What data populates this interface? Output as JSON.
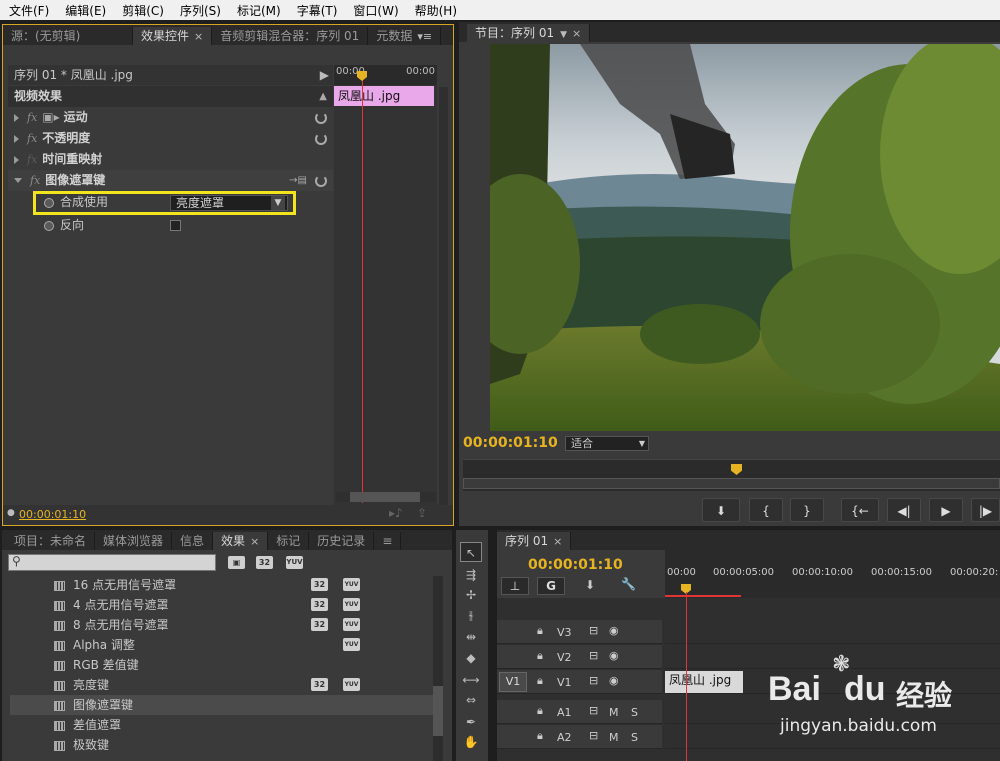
{
  "menu": [
    "文件(F)",
    "编辑(E)",
    "剪辑(C)",
    "序列(S)",
    "标记(M)",
    "字幕(T)",
    "窗口(W)",
    "帮助(H)"
  ],
  "source_tabs": {
    "source": "源：(无剪辑)",
    "effect_controls": "效果控件",
    "audio_mixer": "音频剪辑混合器：序列 01",
    "metadata": "元数据"
  },
  "ec": {
    "sequence": "序列 01 * 凤凰山 .jpg",
    "tc_start": "00:00",
    "tc_end": "00:00",
    "clip": "凤凰山 .jpg",
    "video_effects": "视频效果",
    "effects": [
      "运动",
      "不透明度",
      "时间重映射",
      "图像遮罩键"
    ],
    "composite_label": "合成使用",
    "composite_value": "亮度遮罩",
    "reverse_label": "反向",
    "timecode": "00:00:01:10"
  },
  "program": {
    "tab": "节目：序列 01",
    "timecode": "00:00:01:10",
    "fit": "适合"
  },
  "project_tabs": {
    "project": "项目：未命名",
    "media": "媒体浏览器",
    "info": "信息",
    "effects": "效果",
    "markers": "标记",
    "history": "历史记录"
  },
  "effects_list": [
    {
      "name": "16 点无用信号遮罩",
      "b32": true,
      "yuv": true
    },
    {
      "name": "4 点无用信号遮罩",
      "b32": true,
      "yuv": true
    },
    {
      "name": "8 点无用信号遮罩",
      "b32": true,
      "yuv": true
    },
    {
      "name": "Alpha 调整",
      "b32": false,
      "yuv": true
    },
    {
      "name": "RGB 差值键",
      "b32": false,
      "yuv": false
    },
    {
      "name": "亮度键",
      "b32": true,
      "yuv": true
    },
    {
      "name": "图像遮罩键",
      "b32": false,
      "yuv": false,
      "selected": true
    },
    {
      "name": "差值遮罩",
      "b32": false,
      "yuv": false
    },
    {
      "name": "极致键",
      "b32": false,
      "yuv": false
    }
  ],
  "badges": {
    "b32": "32",
    "yuv": "YUV"
  },
  "timeline": {
    "tab": "序列 01",
    "timecode": "00:00:01:10",
    "ruler": [
      "00:00",
      "00:00:05:00",
      "00:00:10:00",
      "00:00:15:00",
      "00:00:20:"
    ],
    "tracks": [
      "V3",
      "V2",
      "V1",
      "A1",
      "A2"
    ],
    "source_patch": "V1",
    "clip": "凤凰山 .jpg",
    "m": "M",
    "s": "S"
  },
  "watermark": {
    "brand": "Bai",
    "du": "du",
    "jingyan": "经验",
    "url": "jingyan.baidu.com"
  }
}
